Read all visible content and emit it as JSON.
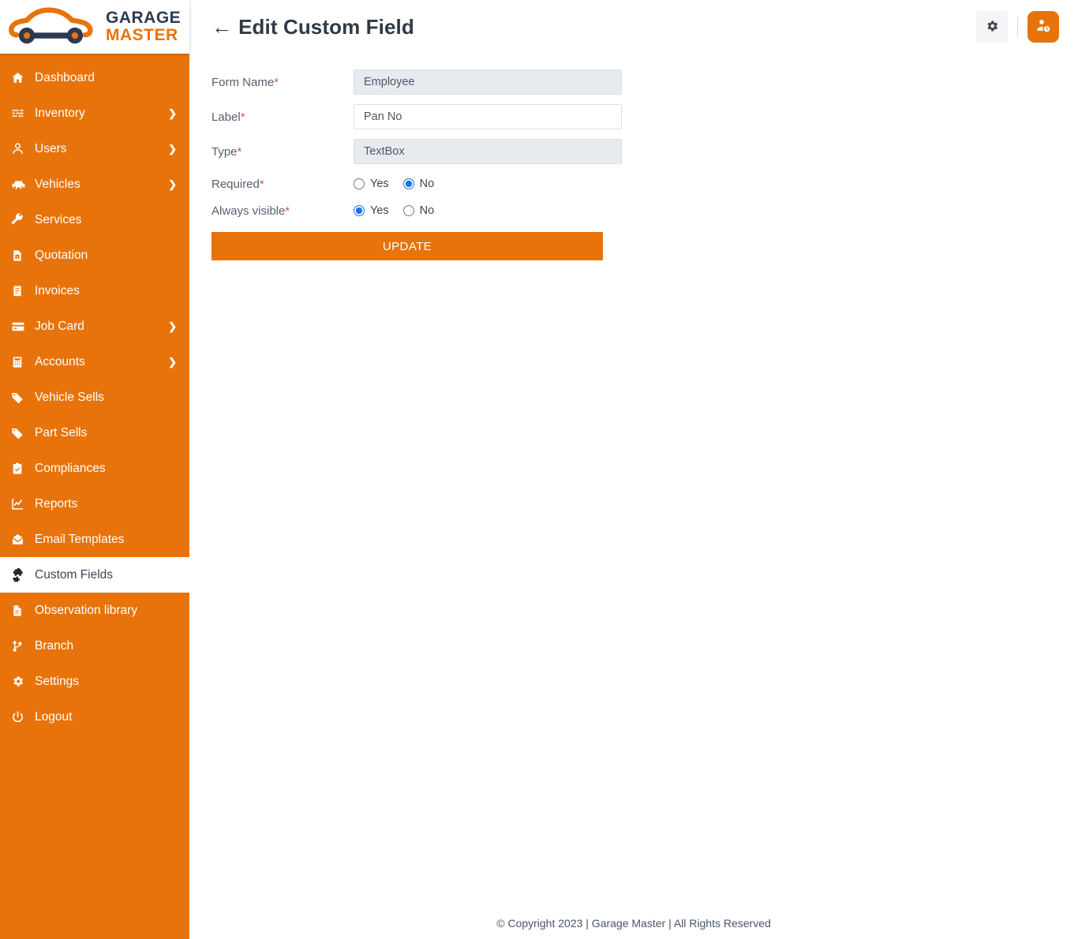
{
  "brand": {
    "name_line1": "GARAGE",
    "name_line2": "MASTER",
    "logo_icon": "car-wrench-logo",
    "accent_color": "#e8730a",
    "dark_color": "#2b3a52"
  },
  "header": {
    "back_arrow": "←",
    "title": "Edit Custom Field",
    "settings_icon": "gear-icon",
    "profile_icon": "user-clock-icon"
  },
  "sidebar": {
    "items": [
      {
        "label": "Dashboard",
        "icon": "home-icon",
        "expandable": false,
        "active": false
      },
      {
        "label": "Inventory",
        "icon": "sliders-icon",
        "expandable": true,
        "active": false
      },
      {
        "label": "Users",
        "icon": "user-icon",
        "expandable": true,
        "active": false
      },
      {
        "label": "Vehicles",
        "icon": "car-icon",
        "expandable": true,
        "active": false
      },
      {
        "label": "Services",
        "icon": "wrench-icon",
        "expandable": false,
        "active": false
      },
      {
        "label": "Quotation",
        "icon": "file-dollar-icon",
        "expandable": false,
        "active": false
      },
      {
        "label": "Invoices",
        "icon": "receipt-icon",
        "expandable": false,
        "active": false
      },
      {
        "label": "Job Card",
        "icon": "card-icon",
        "expandable": true,
        "active": false
      },
      {
        "label": "Accounts",
        "icon": "calculator-icon",
        "expandable": true,
        "active": false
      },
      {
        "label": "Vehicle Sells",
        "icon": "tag-icon",
        "expandable": false,
        "active": false
      },
      {
        "label": "Part Sells",
        "icon": "tag-icon",
        "expandable": false,
        "active": false
      },
      {
        "label": "Compliances",
        "icon": "clipboard-check-icon",
        "expandable": false,
        "active": false
      },
      {
        "label": "Reports",
        "icon": "chart-line-icon",
        "expandable": false,
        "active": false
      },
      {
        "label": "Email Templates",
        "icon": "mail-open-icon",
        "expandable": false,
        "active": false
      },
      {
        "label": "Custom Fields",
        "icon": "puzzle-icon",
        "expandable": false,
        "active": true
      },
      {
        "label": "Observation library",
        "icon": "document-icon",
        "expandable": false,
        "active": false
      },
      {
        "label": "Branch",
        "icon": "code-branch-icon",
        "expandable": false,
        "active": false
      },
      {
        "label": "Settings",
        "icon": "gear-icon",
        "expandable": false,
        "active": false
      },
      {
        "label": "Logout",
        "icon": "power-icon",
        "expandable": false,
        "active": false
      }
    ],
    "chevron": "❯"
  },
  "form": {
    "fields": {
      "form_name": {
        "label": "Form Name",
        "required_mark": "*",
        "value": "Employee",
        "disabled": true
      },
      "label_field": {
        "label": "Label",
        "required_mark": "*",
        "value": "Pan No",
        "disabled": false
      },
      "type": {
        "label": "Type",
        "required_mark": "*",
        "value": "TextBox",
        "disabled": true
      },
      "required": {
        "label": "Required",
        "required_mark": "*",
        "options": [
          "Yes",
          "No"
        ],
        "selected": "No"
      },
      "always_visible": {
        "label": "Always visible",
        "required_mark": "*",
        "options": [
          "Yes",
          "No"
        ],
        "selected": "Yes"
      }
    },
    "submit_label": "UPDATE"
  },
  "footer": {
    "text": "© Copyright 2023 | Garage Master | All Rights Reserved"
  }
}
